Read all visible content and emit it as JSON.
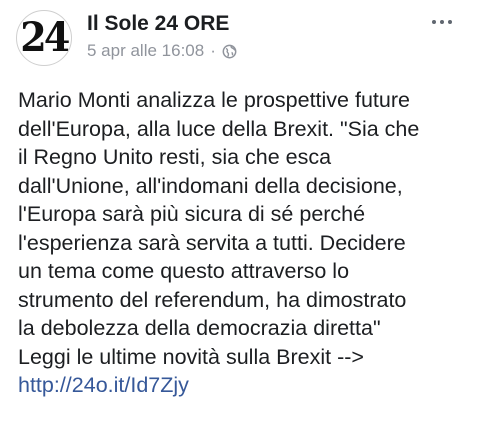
{
  "post": {
    "avatar_text": "24",
    "page_name": "Il Sole 24 ORE",
    "timestamp": "5 apr alle 16:08",
    "separator": "·",
    "privacy_icon": "globe-icon",
    "more_icon": "more-horizontal-icon",
    "body_lines": [
      "Mario Monti analizza le prospettive future",
      "dell'Europa, alla luce della Brexit. \"Sia che",
      "il Regno Unito resti, sia che esca",
      "dall'Unione, all'indomani della decisione,",
      "l'Europa sarà più sicura di sé perché",
      "l'esperienza sarà servita a tutti. Decidere",
      "un tema come questo attraverso lo",
      "strumento del referendum, ha dimostrato",
      "la debolezza della democrazia diretta\"",
      "Leggi le ultime novità sulla Brexit -->"
    ],
    "link": "http://24o.it/Id7Zjy"
  },
  "colors": {
    "text": "#1c1e21",
    "meta": "#90949c",
    "link": "#365899"
  }
}
